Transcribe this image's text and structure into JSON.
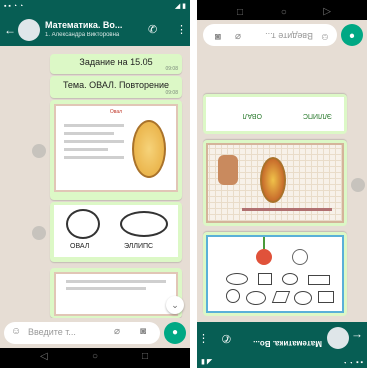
{
  "left_phone": {
    "header": {
      "back_icon": "arrow-left-icon",
      "title": "Математика. Во...",
      "subtitle": "1. Александра Викторовна",
      "call_icon": "call-plus-icon",
      "menu_icon": "more-vertical-icon"
    },
    "messages": [
      {
        "type": "text",
        "text": "Задание на 15.05",
        "time": "09:08"
      },
      {
        "type": "text",
        "text": "Тема. ОВАЛ. Повторение",
        "time": "09:08"
      },
      {
        "type": "image",
        "slide_title": "Овал",
        "time": "09:08"
      },
      {
        "type": "image",
        "labels": [
          "ОВАЛ",
          "ЭЛЛИПС"
        ],
        "time": "09:08"
      },
      {
        "type": "image",
        "time": "09:08"
      }
    ],
    "input": {
      "placeholder": "Введите т...",
      "emoji_icon": "emoji-icon",
      "attach_icon": "paperclip-icon",
      "camera_icon": "camera-icon",
      "mic_icon": "microphone-icon",
      "scroll_down_icon": "chevron-down-icon"
    },
    "nav": {
      "back": "◁",
      "home": "○",
      "recents": "□"
    }
  },
  "right_phone": {
    "orientation": "upside-down",
    "header": {
      "back_icon": "arrow-left-icon",
      "title": "Математика. Во...",
      "call_icon": "call-plus-icon",
      "menu_icon": "more-vertical-icon"
    },
    "messages": [
      {
        "type": "image",
        "labels": [
          "ЭЛЛИПС",
          "ОВАЛ"
        ]
      },
      {
        "type": "image",
        "description_icon": "yellow-oval-with-character"
      },
      {
        "type": "image",
        "description_icon": "worksheet-shapes-flowers"
      }
    ],
    "input": {
      "placeholder": "Введите т...",
      "mic_icon": "microphone-icon"
    },
    "nav": {
      "back": "◁",
      "home": "○",
      "recents": "□"
    }
  },
  "colors": {
    "header": "#075e54",
    "bubble": "#dcf8c6",
    "wallpaper": "#e6ddd4",
    "accent": "#00a884"
  }
}
